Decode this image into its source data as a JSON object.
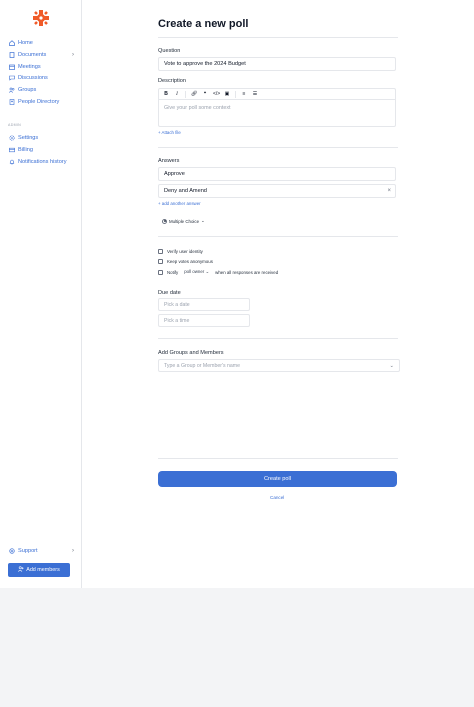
{
  "sidebar": {
    "items": [
      {
        "label": "Home",
        "icon": "home-icon"
      },
      {
        "label": "Documents",
        "icon": "document-icon"
      },
      {
        "label": "Meetings",
        "icon": "calendar-icon"
      },
      {
        "label": "Discussions",
        "icon": "chat-icon"
      },
      {
        "label": "Groups",
        "icon": "users-icon"
      },
      {
        "label": "People Directory",
        "icon": "address-book-icon"
      }
    ],
    "admin_label": "ADMIN",
    "admin_items": [
      {
        "label": "Settings",
        "icon": "gear-icon"
      },
      {
        "label": "Billing",
        "icon": "credit-card-icon"
      },
      {
        "label": "Notifications history",
        "icon": "bell-icon"
      }
    ],
    "support_label": "Support",
    "add_members_label": "Add members",
    "brand_color": "#f05a28",
    "accent_color": "#3b6fd4"
  },
  "form": {
    "title": "Create a new poll",
    "question_label": "Question",
    "question_value": "Vote to approve the 2024 Budget",
    "description_label": "Description",
    "description_placeholder": "Give your poll some context",
    "attach_file": "Attach file",
    "answers_label": "Answers",
    "answers": [
      "Approve",
      "Deny and Amend"
    ],
    "add_answer": "add another answer",
    "answer_type": "Multiple Choice",
    "options": {
      "verify": "Verify user identity",
      "anonymous": "Keep votes anonymous",
      "notify": "Notify",
      "notify_target": "poll owner",
      "notify_when": "when all responses are received"
    },
    "due_date_label": "Due date",
    "date_placeholder": "Pick a date",
    "time_placeholder": "Pick a time",
    "groups_label": "Add Groups and Members",
    "groups_placeholder": "Type a Group or Member's name",
    "submit_label": "Create poll",
    "cancel_label": "Cancel"
  }
}
